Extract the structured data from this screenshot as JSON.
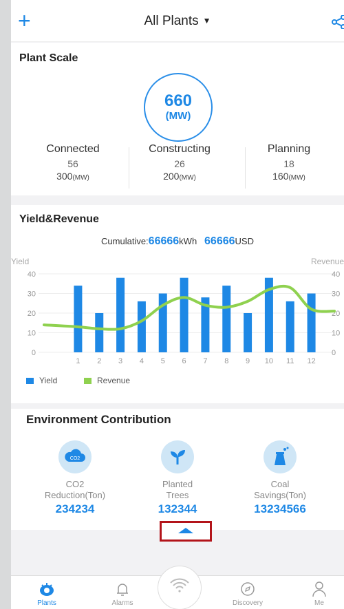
{
  "header": {
    "add_icon": "plus-icon",
    "title": "All Plants",
    "caret": "▼",
    "share_icon": "share-icon"
  },
  "plant_scale": {
    "title": "Plant Scale",
    "total_value": "660",
    "total_unit": "(MW)",
    "stats": [
      {
        "label": "Connected",
        "count": "56",
        "capacity": "300",
        "unit": "(MW)"
      },
      {
        "label": "Constructing",
        "count": "26",
        "capacity": "200",
        "unit": "(MW)"
      },
      {
        "label": "Planning",
        "count": "18",
        "capacity": "160",
        "unit": "(MW)"
      }
    ]
  },
  "yield_revenue": {
    "title": "Yield&Revenue",
    "cumulative_label": "Cumulative:",
    "cumulative_kwh": "66666",
    "kwh_unit": "kWh",
    "cumulative_usd": "66666",
    "usd_unit": "USD"
  },
  "chart_data": {
    "type": "bar",
    "categories": [
      "1",
      "2",
      "3",
      "4",
      "5",
      "6",
      "7",
      "8",
      "9",
      "10",
      "11",
      "12"
    ],
    "series": [
      {
        "name": "Yield",
        "type": "bar",
        "axis": "left",
        "values": [
          34,
          20,
          38,
          26,
          30,
          38,
          28,
          34,
          20,
          38,
          26,
          30
        ],
        "color": "#1e88e5"
      },
      {
        "name": "Revenue",
        "type": "line",
        "axis": "right",
        "values": [
          13,
          12,
          12,
          16,
          24,
          28,
          24,
          23,
          26,
          32,
          33,
          22
        ],
        "color": "#8fd14f"
      }
    ],
    "ylabel": "Yield",
    "y2label": "Revenue",
    "ylim": [
      0,
      40
    ],
    "y2lim": [
      0,
      40
    ],
    "yticks": [
      "0",
      "10",
      "20",
      "30",
      "40"
    ],
    "grid": true,
    "legend_position": "bottom-left"
  },
  "environment": {
    "title": "Environment Contribution",
    "items": [
      {
        "icon": "co2-cloud-icon",
        "icon_text": "CO2",
        "label_line1": "CO2",
        "label_line2": "Reduction(Ton)",
        "value": "234234"
      },
      {
        "icon": "seedling-icon",
        "label_line1": "Planted",
        "label_line2": "Trees",
        "value": "132344"
      },
      {
        "icon": "power-plant-icon",
        "label_line1": "Coal",
        "label_line2": "Savings(Ton)",
        "value": "13234566"
      }
    ]
  },
  "expand_icon": "caret-up-icon",
  "nav": {
    "items": [
      {
        "label": "Plants",
        "icon": "plants-icon",
        "active": true
      },
      {
        "label": "Alarms",
        "icon": "bell-icon",
        "active": false
      },
      {
        "label": "Discovery",
        "icon": "compass-icon",
        "active": false
      },
      {
        "label": "Me",
        "icon": "person-icon",
        "active": false
      }
    ],
    "center_icon": "wifi-icon"
  },
  "colors": {
    "accent": "#1e88e5",
    "revenue": "#8fd14f",
    "highlight_box": "#b3141a"
  }
}
